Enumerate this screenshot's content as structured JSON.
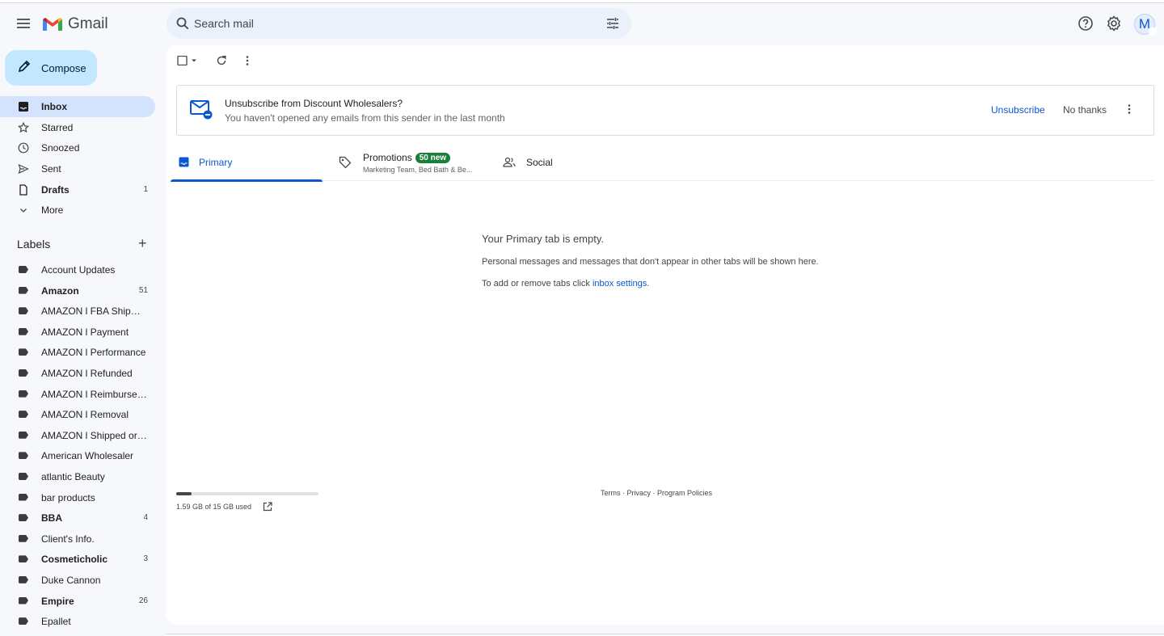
{
  "header": {
    "logo_text": "Gmail",
    "search_placeholder": "Search mail",
    "avatar_letter": "M"
  },
  "sidebar": {
    "compose_label": "Compose",
    "nav": [
      {
        "label": "Inbox",
        "count": "",
        "icon": "inbox-icon",
        "active": true,
        "bold": true
      },
      {
        "label": "Starred",
        "count": "",
        "icon": "star-icon"
      },
      {
        "label": "Snoozed",
        "count": "",
        "icon": "clock-icon"
      },
      {
        "label": "Sent",
        "count": "",
        "icon": "send-icon"
      },
      {
        "label": "Drafts",
        "count": "1",
        "icon": "draft-icon",
        "bold": true
      },
      {
        "label": "More",
        "count": "",
        "icon": "chevron-down-icon"
      }
    ],
    "labels_title": "Labels",
    "labels": [
      {
        "label": "Account Updates",
        "count": ""
      },
      {
        "label": "Amazon",
        "count": "51",
        "bold": true
      },
      {
        "label": "AMAZON l FBA Shipments",
        "count": ""
      },
      {
        "label": "AMAZON l Payment",
        "count": ""
      },
      {
        "label": "AMAZON l Performance",
        "count": ""
      },
      {
        "label": "AMAZON l Refunded",
        "count": ""
      },
      {
        "label": "AMAZON l Reimbursement",
        "count": ""
      },
      {
        "label": "AMAZON l Removal",
        "count": ""
      },
      {
        "label": "AMAZON l Shipped order",
        "count": ""
      },
      {
        "label": "American Wholesaler",
        "count": ""
      },
      {
        "label": "atlantic Beauty",
        "count": ""
      },
      {
        "label": "bar products",
        "count": ""
      },
      {
        "label": "BBA",
        "count": "4",
        "bold": true
      },
      {
        "label": "Client's Info.",
        "count": ""
      },
      {
        "label": "Cosmeticholic",
        "count": "3",
        "bold": true
      },
      {
        "label": "Duke Cannon",
        "count": ""
      },
      {
        "label": "Empire",
        "count": "26",
        "bold": true
      },
      {
        "label": "Epallet",
        "count": ""
      }
    ]
  },
  "banner": {
    "title": "Unsubscribe from Discount Wholesalers?",
    "subtitle": "You haven't opened any emails from this sender in the last month",
    "unsubscribe_label": "Unsubscribe",
    "no_thanks_label": "No thanks"
  },
  "tabs": {
    "primary": "Primary",
    "promotions": "Promotions",
    "promotions_badge": "50 new",
    "promotions_sub": "Marketing Team, Bed Bath & Be...",
    "social": "Social"
  },
  "empty": {
    "title": "Your Primary tab is empty.",
    "line1": "Personal messages and messages that don't appear in other tabs will be shown here.",
    "line2_prefix": "To add or remove tabs click ",
    "line2_link": "inbox settings",
    "line2_suffix": "."
  },
  "storage": {
    "used_text": "1.59 GB of 15 GB used",
    "used_fraction": 0.106
  },
  "footer": {
    "terms": "Terms",
    "sep": " · ",
    "privacy": "Privacy",
    "policies": "Program Policies"
  },
  "colors": {
    "accent": "#0b57d0",
    "compose_bg": "#c2e7ff",
    "active_nav_bg": "#d3e3fd",
    "badge_green": "#188038"
  }
}
